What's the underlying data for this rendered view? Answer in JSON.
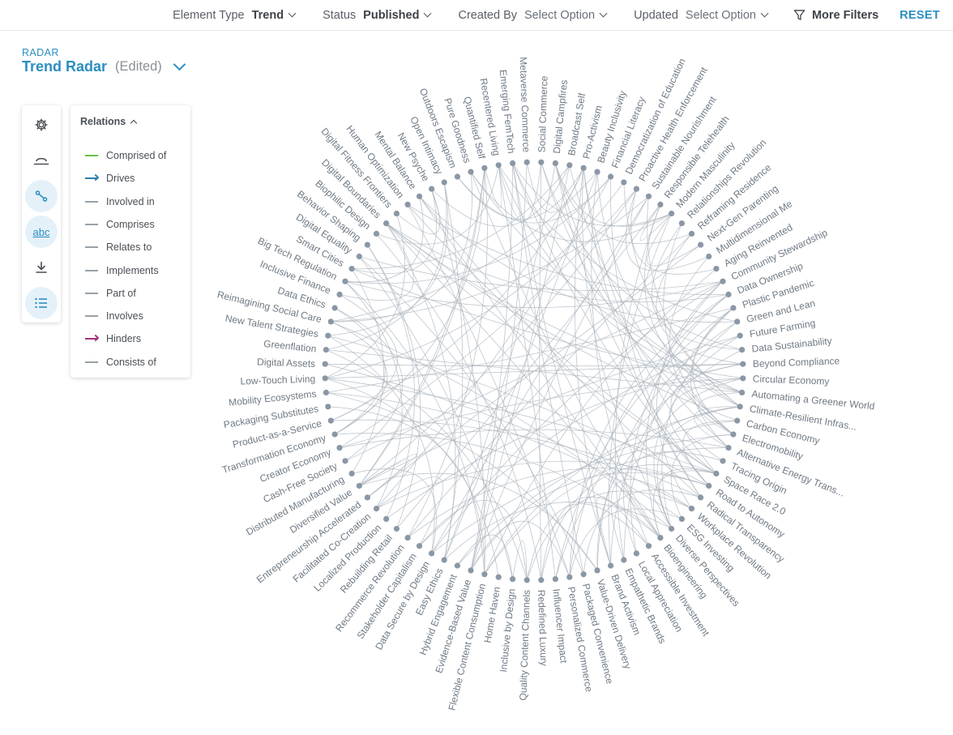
{
  "filters": [
    {
      "label": "Element Type",
      "value": "Trend",
      "placeholder": false
    },
    {
      "label": "Status",
      "value": "Published",
      "placeholder": false
    },
    {
      "label": "Created By",
      "value": "Select Option",
      "placeholder": true
    },
    {
      "label": "Updated",
      "value": "Select Option",
      "placeholder": true
    }
  ],
  "more_filters_label": "More Filters",
  "reset_label": "RESET",
  "breadcrumb": "RADAR",
  "title": "Trend Radar",
  "title_suffix": "(Edited)",
  "toolbar_icons": [
    "gear-icon",
    "bowl-icon",
    "relations-icon",
    "abc-label-icon",
    "download-icon",
    "list-icon"
  ],
  "toolbar_abc_text": "abc",
  "legend": {
    "title": "Relations",
    "items": [
      {
        "label": "Comprised of",
        "color": "#6cc04a",
        "arrow": false
      },
      {
        "label": "Drives",
        "color": "#2c7fa8",
        "arrow": true
      },
      {
        "label": "Involved in",
        "color": "#9aa1a8",
        "arrow": false
      },
      {
        "label": "Comprises",
        "color": "#9aa1a8",
        "arrow": false
      },
      {
        "label": "Relates to",
        "color": "#9aa1a8",
        "arrow": false
      },
      {
        "label": "Implements",
        "color": "#9aa1a8",
        "arrow": false
      },
      {
        "label": "Part of",
        "color": "#9aa1a8",
        "arrow": false
      },
      {
        "label": "Involves",
        "color": "#9aa1a8",
        "arrow": false
      },
      {
        "label": "Hinders",
        "color": "#a3307a",
        "arrow": true
      },
      {
        "label": "Consists of",
        "color": "#9aa1a8",
        "arrow": false
      }
    ]
  },
  "trends": [
    "Social Commerce",
    "Digital Campfires",
    "Broadcast Self",
    "Pro-Activism",
    "Beauty Inclusivity",
    "Financial Literacy",
    "Democratization of Education",
    "Proactive Health Enforcement",
    "Sustainable Nourishment",
    "Responsible Telehealth",
    "Modern Masculinity",
    "Relationships Revolution",
    "Reframing Residence",
    "Next-Gen Parenting",
    "Multidimensional Me",
    "Aging Reinvented",
    "Community Stewardship",
    "Data Ownership",
    "Plastic Pandemic",
    "Green and Lean",
    "Future Farming",
    "Data Sustainability",
    "Beyond Compliance",
    "Circular Economy",
    "Automating a Greener World",
    "Climate-Resilient Infras...",
    "Carbon Economy",
    "Electromobility",
    "Alternative Energy Trans...",
    "Tracing Origin",
    "Space Race 2.0",
    "Road to Autonomy",
    "Radical Transparency",
    "Workplace Revolution",
    "ESG Investing",
    "Diverse Perspectives",
    "Bioengineering",
    "Accessible Investment",
    "Local Appreciation",
    "Empathetic Brands",
    "Brand Activism",
    "Value-Driven Delivery",
    "Packaged Convenience",
    "Personalized Commerce",
    "Influencer Impact",
    "Redefined Luxury",
    "Quality Content Channels",
    "Inclusive by Design",
    "Home Haven",
    "Flexible Content Consumption",
    "Evidence-Based Value",
    "Hybrid Engagement",
    "Easy Ethics",
    "Data Secure by Design",
    "Stakeholder Capitalism",
    "Recommerce Revolution",
    "Rebuilding Retail",
    "Localized Production",
    "Facilitated Co-Creation",
    "Entrepreneurship Accelerated",
    "Diversified Value",
    "Distributed Manufacturing",
    "Cash-Free Society",
    "Creator Economy",
    "Transformation Economy",
    "Product-as-a-Service",
    "Packaging Substitutes",
    "Mobility Ecosystems",
    "Low-Touch Living",
    "Digital Assets",
    "Greenflation",
    "New Talent Strategies",
    "Reimagining Social Care",
    "Data Ethics",
    "Inclusive Finance",
    "Big Tech Regulation",
    "Smart Cities",
    "Digital Equality",
    "Behavior Shaping",
    "Biophilic Design",
    "Digital Boundaries",
    "Digital Fitness Frontiers",
    "Human Optimization",
    "Mental Balance",
    "New Psyche",
    "Open Intimacy",
    "Outdoors Escapism",
    "Pure Goodness",
    "Quantified Self",
    "Recentered Living",
    "Emerging FemTech",
    "Metaverse Commerce"
  ],
  "colors": {
    "accent": "#2b8fc0",
    "node": "#8a97a5",
    "edge": "#a9b3bc"
  }
}
